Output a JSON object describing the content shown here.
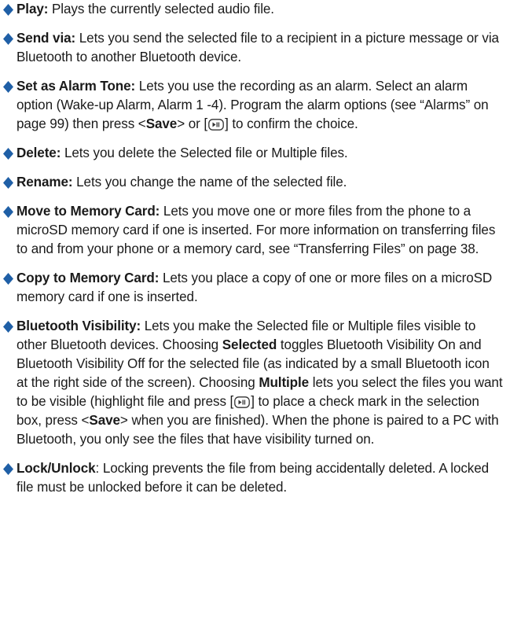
{
  "colors": {
    "bullet": "#1f5fa6",
    "text": "#1a1a1a"
  },
  "icons": {
    "bullet": "diamond-bullet-icon",
    "key": "menu-key-icon"
  },
  "items": [
    {
      "term": "Play:",
      "text": " Plays the currently selected audio file."
    },
    {
      "term": "Send via:",
      "text": " Lets you send the selected file to a recipient in a picture message or via Bluetooth to another Bluetooth device."
    },
    {
      "term": "Set as Alarm Tone:",
      "text_a": " Lets you use the recording as an alarm. Select an alarm option (Wake-up Alarm, Alarm 1 -4). Program the alarm options (see “Alarms” on page 99) then press <",
      "save": "Save",
      "text_b": "> or [",
      "text_c": "] to confirm the choice."
    },
    {
      "term": "Delete:",
      "text": " Lets you delete the Selected file or Multiple files."
    },
    {
      "term": "Rename:",
      "text": " Lets you change the name of the selected file."
    },
    {
      "term": "Move to Memory Card:",
      "text": " Lets you move one or more files from the phone to a microSD memory card if one is inserted. For more information on transferring files to and from your phone or a memory card, see “Transferring Files” on page 38."
    },
    {
      "term": "Copy to Memory Card:",
      "text": " Lets you place a copy of one or more files on a microSD memory card if one is inserted."
    },
    {
      "term": "Bluetooth Visibility:",
      "text_a": " Lets you make the Selected file or Multiple files visible to other Bluetooth devices. Choosing ",
      "selected": "Selected",
      "text_b": " toggles Bluetooth Visibility On and Bluetooth Visibility Off for the selected file (as indicated by a small Bluetooth icon at the right side of the screen). Choosing ",
      "multiple": "Multiple",
      "text_c": " lets you select the files you want to be visible (highlight file and press [",
      "text_d": "] to place a check mark in the selection box, press <",
      "save": "Save",
      "text_e": "> when you are finished). When the phone is paired to a PC with Bluetooth, you only see the files that have visibility turned on."
    },
    {
      "term": "Lock/Unlock",
      "text": ": Locking prevents the file from being accidentally deleted. A locked file must be unlocked before it can be deleted."
    }
  ]
}
